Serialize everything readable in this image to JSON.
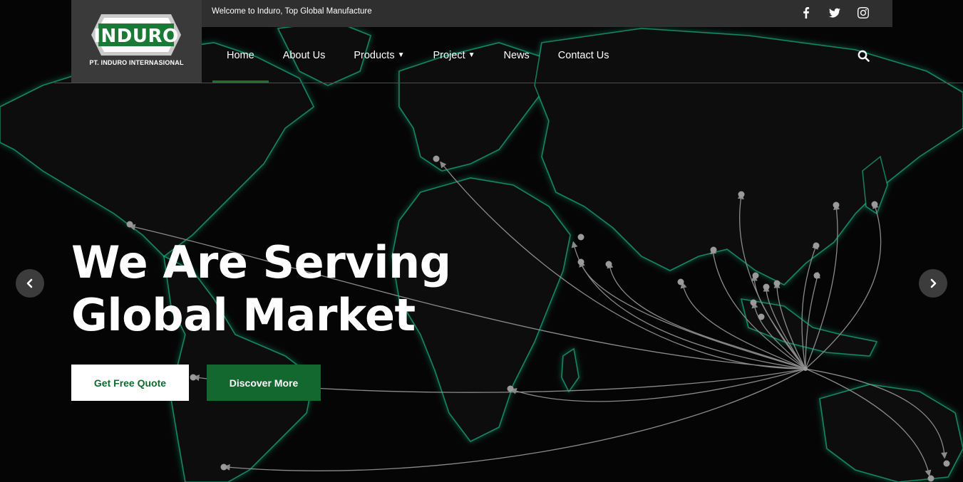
{
  "topbar": {
    "welcome_text": "Welcome to Induro, Top Global Manufacture",
    "social": [
      {
        "icon": "facebook-icon"
      },
      {
        "icon": "twitter-icon"
      },
      {
        "icon": "instagram-icon"
      }
    ]
  },
  "logo": {
    "wordmark": "INDURO",
    "caption": "PT. INDURO INTERNASIONAL"
  },
  "nav": {
    "items": [
      {
        "label": "Home",
        "active": true
      },
      {
        "label": "About Us"
      },
      {
        "label": "Products",
        "dropdown": true
      },
      {
        "label": "Project",
        "dropdown": true
      },
      {
        "label": "News"
      },
      {
        "label": "Contact Us"
      }
    ],
    "search_icon": "search-icon"
  },
  "hero": {
    "title_line1": "We Are Serving",
    "title_line2": "Global Market",
    "primary_button": "Get Free Quote",
    "secondary_button": "Discover More"
  },
  "slider": {
    "prev_icon": "chevron-left-icon",
    "next_icon": "chevron-right-icon"
  },
  "colors": {
    "brand_green": "#13682f",
    "active_underline": "#13752f",
    "topbar_bg": "#2f2f2f",
    "logo_bg": "#3a3a3a",
    "map_glow": "#1fd39a"
  }
}
